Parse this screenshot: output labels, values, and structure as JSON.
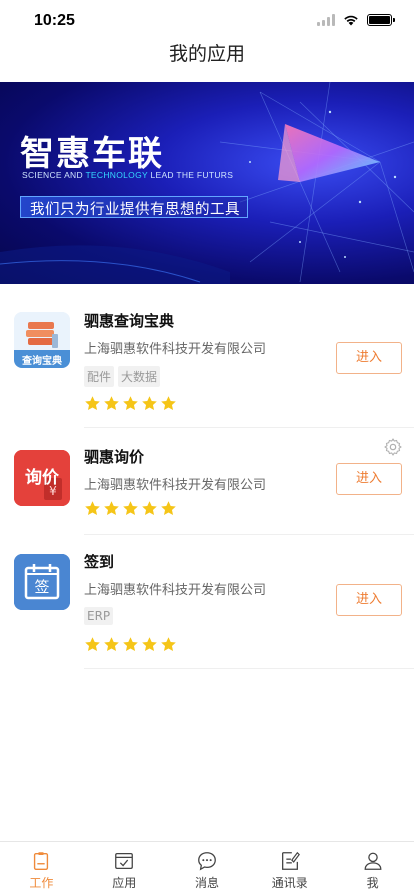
{
  "status_bar": {
    "time": "10:25"
  },
  "nav": {
    "title": "我的应用"
  },
  "banner": {
    "title": "智惠车联",
    "subtitle_part1": "SCIENCE AND ",
    "subtitle_highlight": "TECHNOLOGY",
    "subtitle_part2": " LEAD THE FUTURS",
    "tagline": "我们只为行业提供有思想的工具"
  },
  "apps": [
    {
      "name": "驷惠查询宝典",
      "company": "上海驷惠软件科技开发有限公司",
      "tags": [
        "配件",
        "大数据"
      ],
      "rating": 5,
      "icon": "book-stack-icon",
      "icon_label": "查询宝典",
      "button": "进入"
    },
    {
      "name": "驷惠询价",
      "company": "上海驷惠软件科技开发有限公司",
      "tags": [],
      "rating": 5,
      "icon": "inquiry-icon",
      "icon_label": "询价",
      "button": "进入"
    },
    {
      "name": "签到",
      "company": "上海驷惠软件科技开发有限公司",
      "tags": [
        "ERP"
      ],
      "rating": 5,
      "icon": "calendar-sign-icon",
      "icon_label": "签",
      "button": "进入"
    }
  ],
  "tabs": [
    {
      "label": "工作",
      "icon": "clipboard-icon",
      "active": true
    },
    {
      "label": "应用",
      "icon": "checkbox-icon",
      "active": false
    },
    {
      "label": "消息",
      "icon": "chat-bubble-icon",
      "active": false
    },
    {
      "label": "通讯录",
      "icon": "note-edit-icon",
      "active": false
    },
    {
      "label": "我",
      "icon": "user-icon",
      "active": false
    }
  ],
  "colors": {
    "accent": "#ef8a3a",
    "star": "#f5c518",
    "banner_bg": "#1b1fb8"
  }
}
